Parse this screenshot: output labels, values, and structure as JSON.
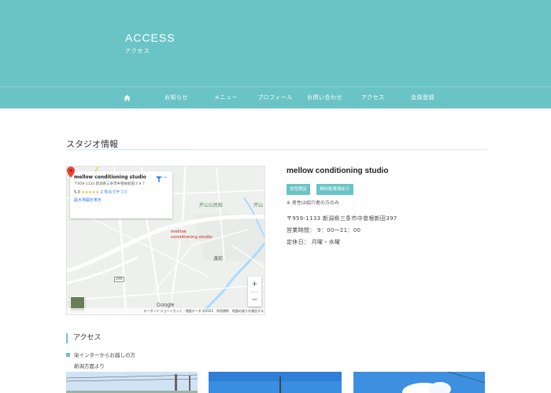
{
  "hero": {
    "title": "ACCESS",
    "subtitle": "アクセス"
  },
  "nav": {
    "home_icon": "home-icon",
    "items": [
      "お知らせ",
      "メニュー",
      "プロフィール",
      "お問い合わせ",
      "アクセス",
      "会員登録"
    ]
  },
  "section": {
    "title": "スタジオ情報"
  },
  "map": {
    "card_title": "mellow conditioning studio",
    "card_address": "〒959-1133 新潟県三条市中曽根新田３９７",
    "rating": "5.0",
    "stars": "★★★★★",
    "reviews": "2 件のクチコミ",
    "larger_map_link": "拡大地図を表示",
    "route_label": "ルート",
    "pin_label_line1": "mellow",
    "pin_label_line2": "conditioning studio",
    "park_label": "芹山公民館",
    "park_label2": "芹山",
    "place_label": "渡前",
    "road_number": "290",
    "zoom_in": "+",
    "zoom_out": "−",
    "google": "Google",
    "footer": "キーボード ショートカット　地図データ ©2022　利用規約　地図の誤りを報告する"
  },
  "studio": {
    "name": "mellow conditioning studio",
    "tags": [
      "女性限定",
      "無料駐車場あり"
    ],
    "note": "※ 男性は紹介者の方のみ",
    "address": "〒959-1133 新潟県三条市中曽根新田397",
    "hours": "営業時間： 9：00～21：00",
    "closed": "定休日： 月曜・水曜"
  },
  "access": {
    "heading": "アクセス",
    "route_title": "栄インターからお越しの方",
    "route_sub": "新潟方面より"
  },
  "colors": {
    "accent": "#6ac4c6"
  }
}
